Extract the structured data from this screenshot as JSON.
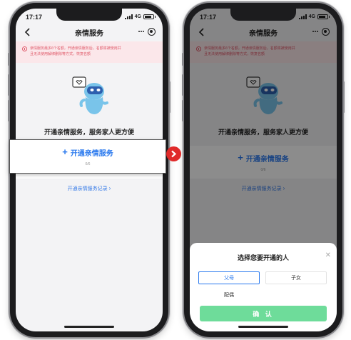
{
  "status_bar": {
    "time": "17:17",
    "network": "4G"
  },
  "nav": {
    "title": "亲情服务"
  },
  "notice": {
    "line1": "亲情服务最多6个名额，开通亲情服务后，名额将被使用并",
    "line2": "且无法使用解绑删除等方式，恢复名额"
  },
  "slogan": "开通亲情服务，服务家人更方便",
  "open_service": {
    "label": "开通亲情服务",
    "count": "0/6"
  },
  "record_link": "开通亲情服务记录",
  "sheet": {
    "title": "选择您要开通的人",
    "options": [
      "父母",
      "子女",
      "配偶"
    ],
    "selected": "父母",
    "confirm": "确 认"
  },
  "colors": {
    "accent": "#2a79ee",
    "notice_bg": "#fbe7ea",
    "notice_text": "#e05a6a",
    "confirm": "#6edc9a",
    "arrow": "#e02a2a"
  }
}
